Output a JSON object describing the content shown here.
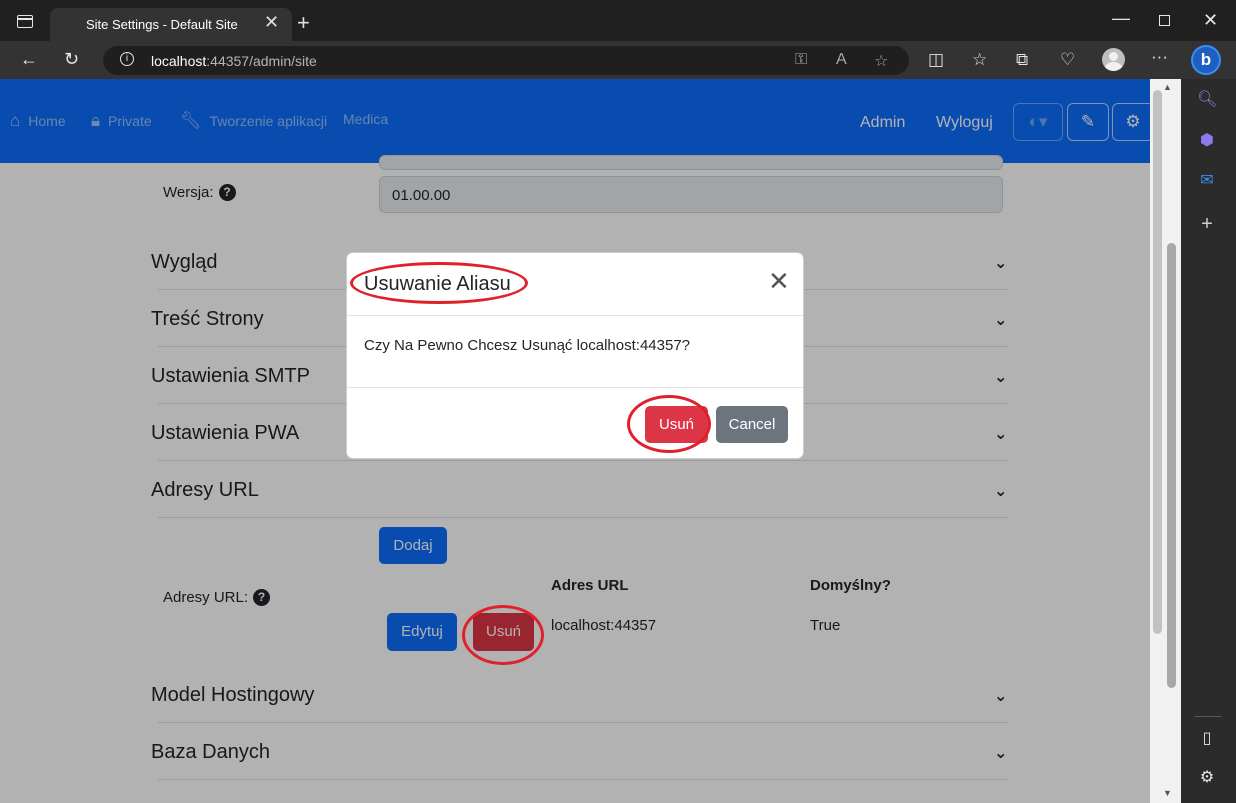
{
  "browser": {
    "tab_title": "Site Settings - Default Site",
    "address_host": "localhost",
    "address_path": ":44357/admin/site"
  },
  "navbar": {
    "items": [
      {
        "label": "Home",
        "icon": "home-icon"
      },
      {
        "label": "Private",
        "icon": "lock-icon"
      },
      {
        "label": "Tworzenie aplikacji",
        "icon": "wrench-icon"
      },
      {
        "label": "Medica",
        "icon": ""
      }
    ],
    "admin_label": "Admin",
    "logout_label": "Wyloguj"
  },
  "form": {
    "version_label": "Wersja:",
    "version_value": "01.00.00"
  },
  "sections": {
    "appearance": "Wygląd",
    "content": "Treść Strony",
    "smtp": "Ustawienia SMTP",
    "pwa": "Ustawienia PWA",
    "urls": "Adresy URL",
    "hosting": "Model Hostingowy",
    "database": "Baza Danych"
  },
  "urls": {
    "add_label": "Dodaj",
    "field_label": "Adresy URL:",
    "col_url": "Adres URL",
    "col_default": "Domyślny?",
    "rows": [
      {
        "edit": "Edytuj",
        "delete": "Usuń",
        "url": "localhost:44357",
        "default": "True"
      }
    ]
  },
  "modal": {
    "title": "Usuwanie Aliasu",
    "body": "Czy Na Pewno Chcesz Usunąć localhost:44357?",
    "delete_label": "Usuń",
    "cancel_label": "Cancel"
  }
}
